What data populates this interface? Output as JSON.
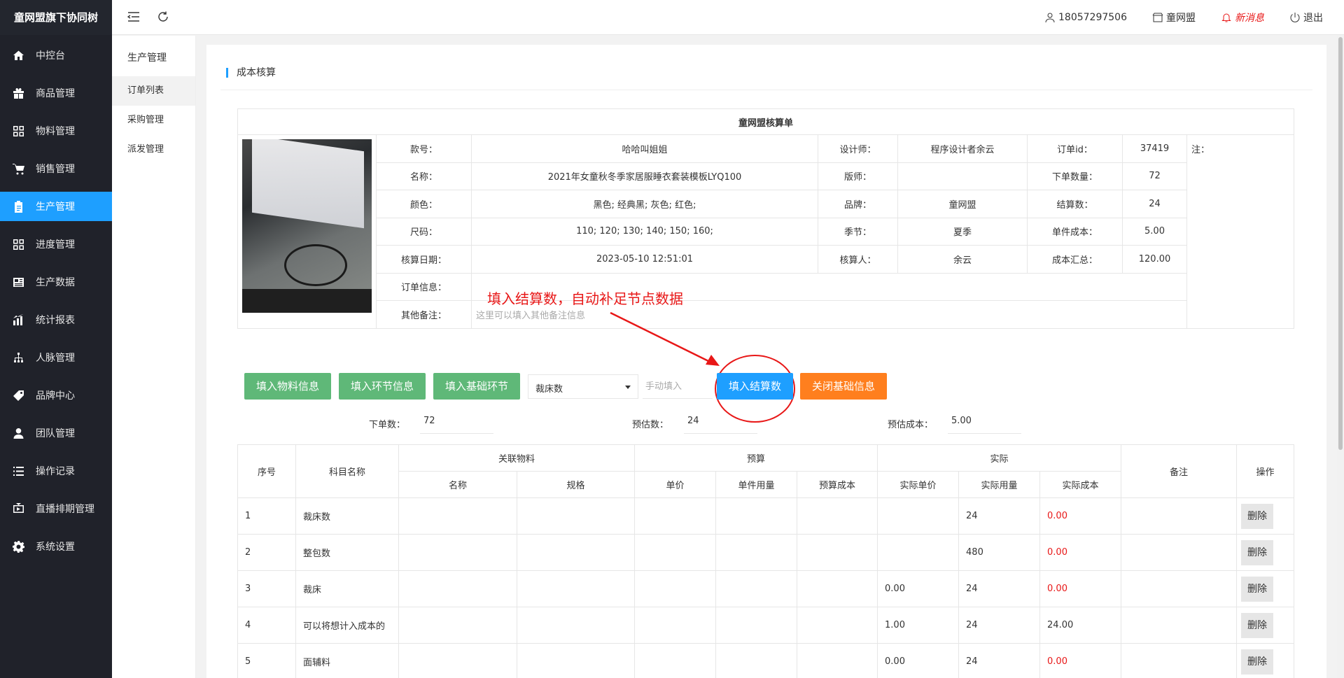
{
  "app": {
    "brand": "童网盟旗下协同树"
  },
  "sidebar": {
    "items": [
      {
        "label": "中控台",
        "icon": "home-icon"
      },
      {
        "label": "商品管理",
        "icon": "gift-icon"
      },
      {
        "label": "物料管理",
        "icon": "grid-icon"
      },
      {
        "label": "销售管理",
        "icon": "cart-icon"
      },
      {
        "label": "生产管理",
        "icon": "clipboard-icon",
        "active": true
      },
      {
        "label": "进度管理",
        "icon": "grid-icon"
      },
      {
        "label": "生产数据",
        "icon": "news-icon"
      },
      {
        "label": "统计报表",
        "icon": "chart-icon"
      },
      {
        "label": "人脉管理",
        "icon": "network-icon"
      },
      {
        "label": "品牌中心",
        "icon": "tag-icon"
      },
      {
        "label": "团队管理",
        "icon": "user-icon"
      },
      {
        "label": "操作记录",
        "icon": "list-icon"
      },
      {
        "label": "直播排期管理",
        "icon": "tv-icon"
      },
      {
        "label": "系统设置",
        "icon": "gear-icon"
      }
    ]
  },
  "header": {
    "phone": "18057297506",
    "shop": "童网盟",
    "new_msg": "新消息",
    "logout": "退出"
  },
  "subnav": {
    "title": "生产管理",
    "items": [
      {
        "label": "订单列表",
        "active": true
      },
      {
        "label": "采购管理"
      },
      {
        "label": "派发管理"
      }
    ]
  },
  "section": {
    "title": "成本核算"
  },
  "sheet": {
    "title": "童网盟核算单",
    "labels": {
      "style_no": "款号：",
      "designer": "设计师：",
      "order_id": "订单id：",
      "note": "注：",
      "name": "名称：",
      "pattern_maker": "版师：",
      "order_qty": "下单数量：",
      "color": "颜色：",
      "brand": "品牌：",
      "settle_qty": "结算数：",
      "size": "尺码：",
      "season": "季节：",
      "unit_cost": "单件成本：",
      "calc_date": "核算日期：",
      "accountant": "核算人：",
      "total_cost": "成本汇总：",
      "order_info": "订单信息：",
      "other_note": "其他备注："
    },
    "values": {
      "style_no": "哈哈叫姐姐",
      "designer": "程序设计者余云",
      "order_id": "37419",
      "name": "2021年女童秋冬季家居服睡衣套装模板LYQ100",
      "pattern_maker": "",
      "order_qty": "72",
      "color": "黑色; 经典黑; 灰色; 红色;",
      "brand": "童网盟",
      "settle_qty": "24",
      "size": "110; 120; 130; 140; 150; 160;",
      "season": "夏季",
      "unit_cost": "5.00",
      "calc_date": "2023-05-10 12:51:01",
      "accountant": "余云",
      "total_cost": "120.00",
      "order_info": "",
      "other_note_placeholder": "这里可以填入其他备注信息"
    }
  },
  "annotation": {
    "text": "填入结算数，自动补足节点数据"
  },
  "toolbar": {
    "btn_material": "填入物料信息",
    "btn_step": "填入环节信息",
    "btn_basic_step": "填入基础环节",
    "select_value": "裁床数",
    "manual_placeholder": "手动填入",
    "btn_settle": "填入结算数",
    "btn_close": "关闭基础信息"
  },
  "summary": {
    "order_label": "下单数：",
    "order_value": "72",
    "est_label": "预估数：",
    "est_value": "24",
    "est_cost_label": "预估成本：",
    "est_cost_value": "5.00"
  },
  "table": {
    "headers": {
      "seq": "序号",
      "subject": "科目名称",
      "material": "关联物料",
      "budget": "预算",
      "actual": "实际",
      "remark": "备注",
      "op": "操作",
      "m_name": "名称",
      "m_spec": "规格",
      "b_price": "单价",
      "b_usage": "单件用量",
      "b_cost": "预算成本",
      "a_price": "实际单价",
      "a_usage": "实际用量",
      "a_cost": "实际成本"
    },
    "rows": [
      {
        "seq": "1",
        "subject": "裁床数",
        "a_price": "",
        "a_usage": "24",
        "a_cost": "0.00",
        "red": true
      },
      {
        "seq": "2",
        "subject": "整包数",
        "a_price": "",
        "a_usage": "480",
        "a_cost": "0.00",
        "red": true
      },
      {
        "seq": "3",
        "subject": "裁床",
        "a_price": "0.00",
        "a_usage": "24",
        "a_cost": "0.00",
        "red": true
      },
      {
        "seq": "4",
        "subject": "可以将想计入成本的",
        "a_price": "1.00",
        "a_usage": "24",
        "a_cost": "24.00",
        "red": false
      },
      {
        "seq": "5",
        "subject": "面辅料",
        "a_price": "0.00",
        "a_usage": "24",
        "a_cost": "0.00",
        "red": true
      }
    ],
    "delete_label": "删除"
  }
}
